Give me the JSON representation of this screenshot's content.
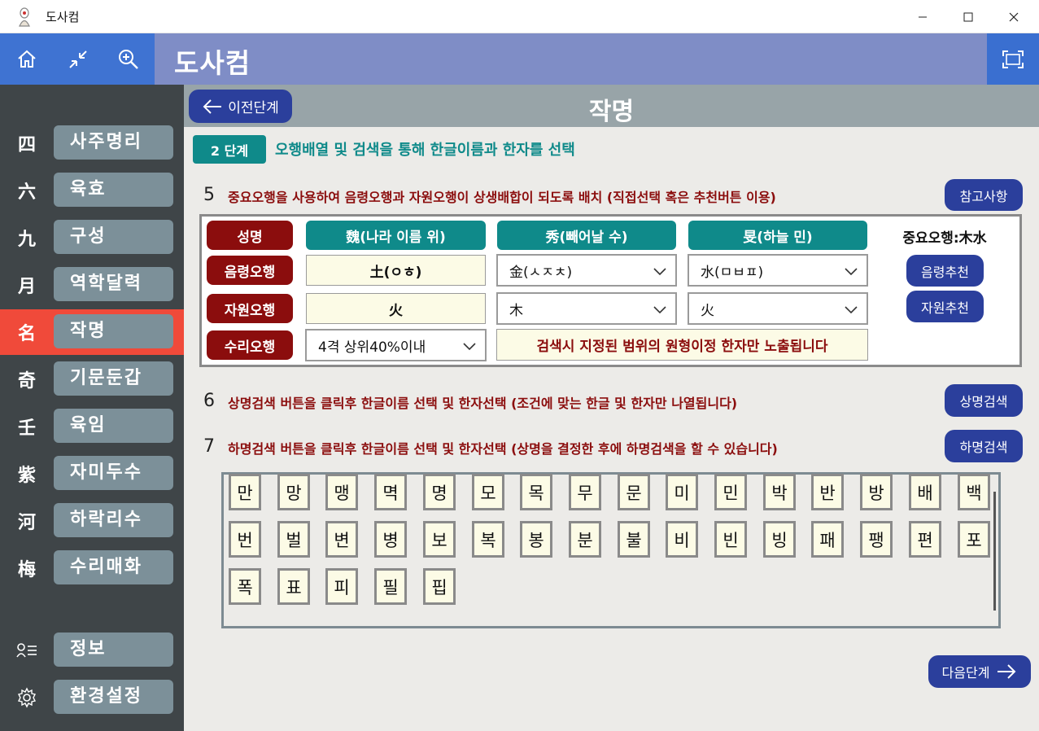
{
  "window": {
    "title": "도사컴",
    "controls": [
      "minimize",
      "maximize",
      "close"
    ]
  },
  "header": {
    "title": "도사컴",
    "icons": [
      "home-icon",
      "shrink-icon",
      "zoom-in-icon",
      "fullscreen-icon"
    ]
  },
  "sidebar": {
    "items": [
      {
        "glyph": "四",
        "label": "사주명리",
        "active": false
      },
      {
        "glyph": "六",
        "label": "육효",
        "active": false
      },
      {
        "glyph": "九",
        "label": "구성",
        "active": false
      },
      {
        "glyph": "月",
        "label": "역학달력",
        "active": false
      },
      {
        "glyph": "名",
        "label": "작명",
        "active": true
      },
      {
        "glyph": "奇",
        "label": "기문둔갑",
        "active": false
      },
      {
        "glyph": "壬",
        "label": "육임",
        "active": false
      },
      {
        "glyph": "紫",
        "label": "자미두수",
        "active": false
      },
      {
        "glyph": "河",
        "label": "하락리수",
        "active": false
      },
      {
        "glyph": "梅",
        "label": "수리매화",
        "active": false
      }
    ],
    "bottom_items": [
      {
        "icon": "profile-list-icon",
        "label": "정보"
      },
      {
        "icon": "gear-icon",
        "label": "환경설정"
      }
    ]
  },
  "main": {
    "prev_button": "이전단계",
    "title": "작명",
    "step_badge": "2 단계",
    "step_text": "오행배열 및 검색을 통해 한글이름과 한자를 선택",
    "section5": {
      "number": "5",
      "text": "중요오행을 사용하여 음령오행과 자원오행이 상생배합이 되도록 배치 (직접선택 혹은 추천버튼 이용)",
      "button": "참고사항"
    },
    "table": {
      "row_labels": [
        "성명",
        "음령오행",
        "자원오행",
        "수리오행"
      ],
      "columns": [
        "魏(나라 이름 위)",
        "秀(빼어날 수)",
        "旻(하늘 민)"
      ],
      "eumryeong": [
        "土(ㅇㅎ)",
        "金(ㅅㅈㅊ)",
        "水(ㅁㅂㅍ)"
      ],
      "jawon": [
        "火",
        "木",
        "火"
      ],
      "suri_select": "4격 상위40%이내",
      "notice": "검색시 지정된 범위의 원형이정 한자만 노출됩니다",
      "important_label": "중요오행:木水",
      "recommend_eum": "음령추천",
      "recommend_jawon": "자원추천"
    },
    "section6": {
      "number": "6",
      "text": "상명검색 버튼을 클릭후 한글이름 선택 및 한자선택 (조건에 맞는 한글 및 한자만 나열됩니다)",
      "button": "상명검색"
    },
    "section7": {
      "number": "7",
      "text": "하명검색 버튼을 클릭후 한글이름 선택 및 한자선택 (상명을 결정한 후에 하명검색을 할 수 있습니다)",
      "button": "하명검색"
    },
    "name_grid": [
      "만",
      "망",
      "맹",
      "멱",
      "명",
      "모",
      "목",
      "무",
      "문",
      "미",
      "민",
      "박",
      "반",
      "방",
      "배",
      "백",
      "번",
      "벌",
      "변",
      "병",
      "보",
      "복",
      "봉",
      "분",
      "불",
      "비",
      "빈",
      "빙",
      "패",
      "팽",
      "편",
      "포",
      "폭",
      "표",
      "피",
      "필",
      "핍"
    ],
    "next_button": "다음단계"
  },
  "colors": {
    "header_bg": "#7f8dc6",
    "header_left_bg": "#3f73d2",
    "sidebar_bg": "#3f4548",
    "sidebar_active": "#f04a3a",
    "sidebar_button": "#7c9099",
    "teal": "#0f8a8a",
    "maroon": "#8b0d0d",
    "navy_button": "#2b3f9c"
  }
}
